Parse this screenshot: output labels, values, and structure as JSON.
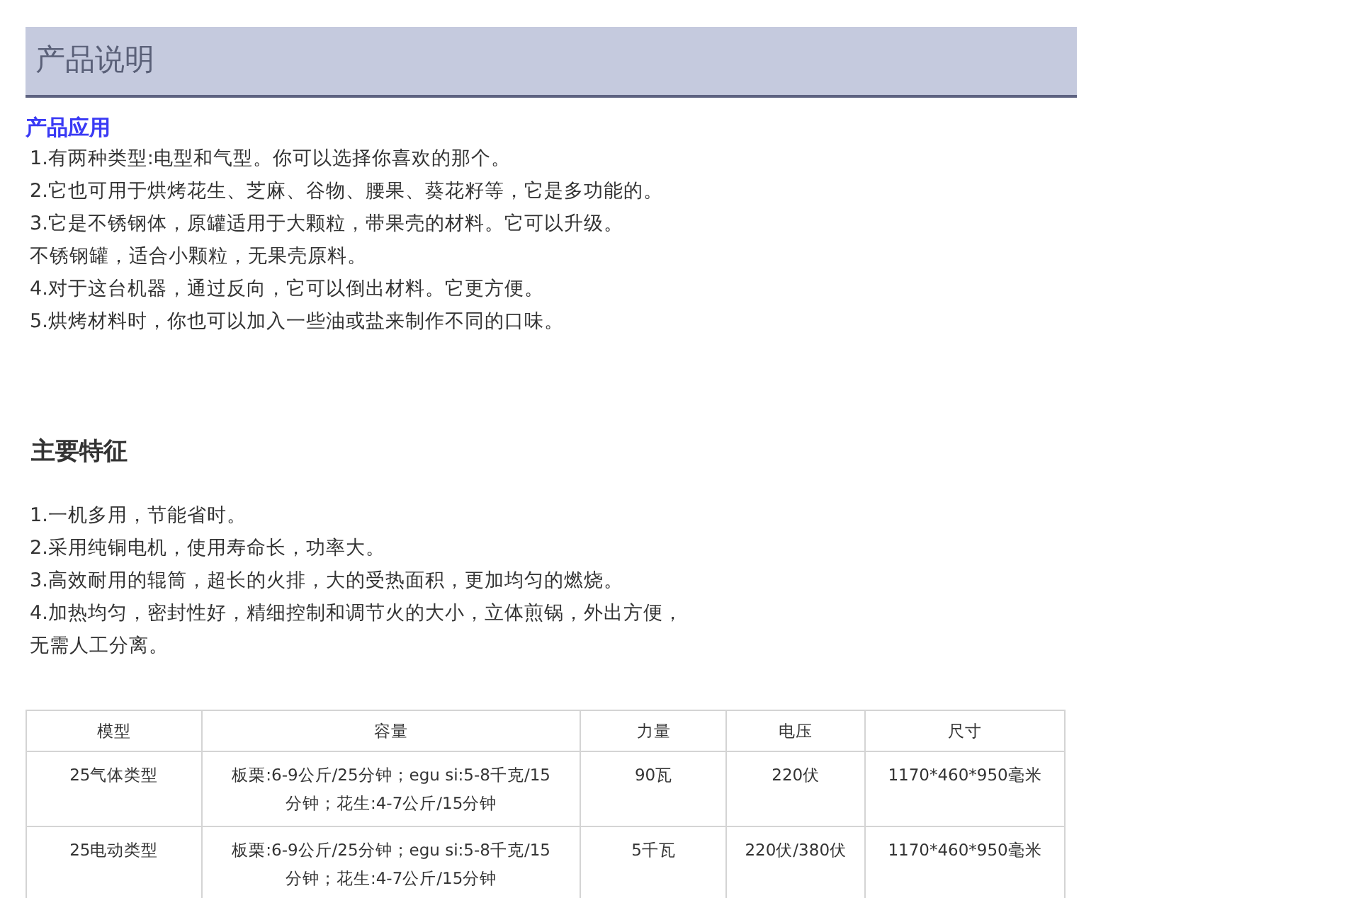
{
  "header": {
    "title": "产品说明"
  },
  "application": {
    "heading": "产品应用",
    "lines": [
      "1.有两种类型:电型和气型。你可以选择你喜欢的那个。",
      "2.它也可用于烘烤花生、芝麻、谷物、腰果、葵花籽等，它是多功能的。",
      "3.它是不锈钢体，原罐适用于大颗粒，带果壳的材料。它可以升级。",
      "不锈钢罐，适合小颗粒，无果壳原料。",
      "4.对于这台机器，通过反向，它可以倒出材料。它更方便。",
      "5.烘烤材料时，你也可以加入一些油或盐来制作不同的口味。"
    ]
  },
  "features": {
    "heading": "主要特征",
    "lines": [
      "1.一机多用，节能省时。",
      "2.采用纯铜电机，使用寿命长，功率大。",
      "3.高效耐用的辊筒，超长的火排，大的受热面积，更加均匀的燃烧。",
      "4.加热均匀，密封性好，精细控制和调节火的大小，立体煎锅，外出方便，",
      "无需人工分离。"
    ]
  },
  "table": {
    "columns": [
      "模型",
      "容量",
      "力量",
      "电压",
      "尺寸"
    ],
    "rows": [
      [
        "25气体类型",
        "板栗:6-9公斤/25分钟；egu si:5-8千克/15分钟；花生:4-7公斤/15分钟",
        "90瓦",
        "220伏",
        "1170*460*950毫米"
      ],
      [
        "25电动类型",
        "板栗:6-9公斤/25分钟；egu si:5-8千克/15分钟；花生:4-7公斤/15分钟",
        "5千瓦",
        "220伏/380伏",
        "1170*460*950毫米"
      ]
    ]
  }
}
